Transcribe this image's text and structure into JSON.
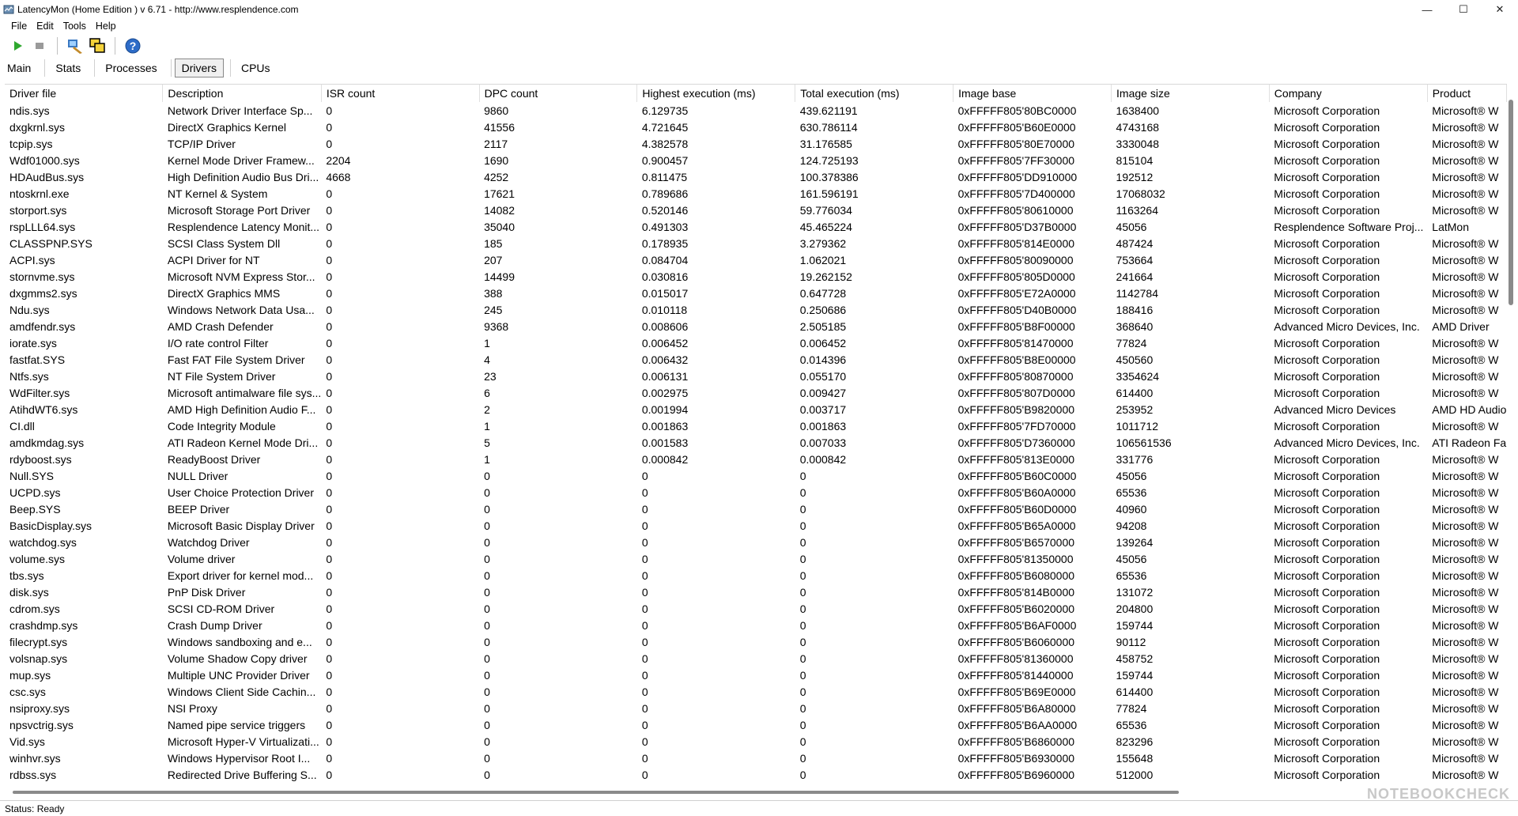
{
  "window": {
    "title": "LatencyMon  (Home Edition )  v 6.71 - http://www.resplendence.com",
    "controls": {
      "minimize": "—",
      "maximize": "☐",
      "close": "✕"
    }
  },
  "menu": [
    "File",
    "Edit",
    "Tools",
    "Help"
  ],
  "toolbar": [
    "start-icon",
    "stop-icon",
    "driver-tool-icon",
    "windows-icon",
    "help-icon"
  ],
  "tabs": [
    {
      "label": "Main",
      "active": false
    },
    {
      "label": "Stats",
      "active": false
    },
    {
      "label": "Processes",
      "active": false
    },
    {
      "label": "Drivers",
      "active": true
    },
    {
      "label": "CPUs",
      "active": false
    }
  ],
  "columns": [
    "Driver file",
    "Description",
    "ISR count",
    "DPC count",
    "Highest execution (ms)",
    "Total execution (ms)",
    "Image base",
    "Image size",
    "Company",
    "Product"
  ],
  "rows": [
    [
      "ndis.sys",
      "Network Driver Interface Sp...",
      "0",
      "9860",
      "6.129735",
      "439.621191",
      "0xFFFFF805'80BC0000",
      "1638400",
      "Microsoft Corporation",
      "Microsoft® W"
    ],
    [
      "dxgkrnl.sys",
      "DirectX Graphics Kernel",
      "0",
      "41556",
      "4.721645",
      "630.786114",
      "0xFFFFF805'B60E0000",
      "4743168",
      "Microsoft Corporation",
      "Microsoft® W"
    ],
    [
      "tcpip.sys",
      "TCP/IP Driver",
      "0",
      "2117",
      "4.382578",
      "31.176585",
      "0xFFFFF805'80E70000",
      "3330048",
      "Microsoft Corporation",
      "Microsoft® W"
    ],
    [
      "Wdf01000.sys",
      "Kernel Mode Driver Framew...",
      "2204",
      "1690",
      "0.900457",
      "124.725193",
      "0xFFFFF805'7FF30000",
      "815104",
      "Microsoft Corporation",
      "Microsoft® W"
    ],
    [
      "HDAudBus.sys",
      "High Definition Audio Bus Dri...",
      "4668",
      "4252",
      "0.811475",
      "100.378386",
      "0xFFFFF805'DD910000",
      "192512",
      "Microsoft Corporation",
      "Microsoft® W"
    ],
    [
      "ntoskrnl.exe",
      "NT Kernel & System",
      "0",
      "17621",
      "0.789686",
      "161.596191",
      "0xFFFFF805'7D400000",
      "17068032",
      "Microsoft Corporation",
      "Microsoft® W"
    ],
    [
      "storport.sys",
      "Microsoft Storage Port Driver",
      "0",
      "14082",
      "0.520146",
      "59.776034",
      "0xFFFFF805'80610000",
      "1163264",
      "Microsoft Corporation",
      "Microsoft® W"
    ],
    [
      "rspLLL64.sys",
      "Resplendence Latency Monit...",
      "0",
      "35040",
      "0.491303",
      "45.465224",
      "0xFFFFF805'D37B0000",
      "45056",
      "Resplendence Software Proj...",
      "LatMon"
    ],
    [
      "CLASSPNP.SYS",
      "SCSI Class System Dll",
      "0",
      "185",
      "0.178935",
      "3.279362",
      "0xFFFFF805'814E0000",
      "487424",
      "Microsoft Corporation",
      "Microsoft® W"
    ],
    [
      "ACPI.sys",
      "ACPI Driver for NT",
      "0",
      "207",
      "0.084704",
      "1.062021",
      "0xFFFFF805'80090000",
      "753664",
      "Microsoft Corporation",
      "Microsoft® W"
    ],
    [
      "stornvme.sys",
      "Microsoft NVM Express Stor...",
      "0",
      "14499",
      "0.030816",
      "19.262152",
      "0xFFFFF805'805D0000",
      "241664",
      "Microsoft Corporation",
      "Microsoft® W"
    ],
    [
      "dxgmms2.sys",
      "DirectX Graphics MMS",
      "0",
      "388",
      "0.015017",
      "0.647728",
      "0xFFFFF805'E72A0000",
      "1142784",
      "Microsoft Corporation",
      "Microsoft® W"
    ],
    [
      "Ndu.sys",
      "Windows Network Data Usa...",
      "0",
      "245",
      "0.010118",
      "0.250686",
      "0xFFFFF805'D40B0000",
      "188416",
      "Microsoft Corporation",
      "Microsoft® W"
    ],
    [
      "amdfendr.sys",
      "AMD Crash Defender",
      "0",
      "9368",
      "0.008606",
      "2.505185",
      "0xFFFFF805'B8F00000",
      "368640",
      "Advanced Micro Devices, Inc.",
      "AMD Driver"
    ],
    [
      "iorate.sys",
      "I/O rate control Filter",
      "0",
      "1",
      "0.006452",
      "0.006452",
      "0xFFFFF805'81470000",
      "77824",
      "Microsoft Corporation",
      "Microsoft® W"
    ],
    [
      "fastfat.SYS",
      "Fast FAT File System Driver",
      "0",
      "4",
      "0.006432",
      "0.014396",
      "0xFFFFF805'B8E00000",
      "450560",
      "Microsoft Corporation",
      "Microsoft® W"
    ],
    [
      "Ntfs.sys",
      "NT File System Driver",
      "0",
      "23",
      "0.006131",
      "0.055170",
      "0xFFFFF805'80870000",
      "3354624",
      "Microsoft Corporation",
      "Microsoft® W"
    ],
    [
      "WdFilter.sys",
      "Microsoft antimalware file sys...",
      "0",
      "6",
      "0.002975",
      "0.009427",
      "0xFFFFF805'807D0000",
      "614400",
      "Microsoft Corporation",
      "Microsoft® W"
    ],
    [
      "AtihdWT6.sys",
      "AMD High Definition Audio F...",
      "0",
      "2",
      "0.001994",
      "0.003717",
      "0xFFFFF805'B9820000",
      "253952",
      "Advanced Micro Devices",
      "AMD HD Audio"
    ],
    [
      "CI.dll",
      "Code Integrity Module",
      "0",
      "1",
      "0.001863",
      "0.001863",
      "0xFFFFF805'7FD70000",
      "1011712",
      "Microsoft Corporation",
      "Microsoft® W"
    ],
    [
      "amdkmdag.sys",
      "ATI Radeon Kernel Mode Dri...",
      "0",
      "5",
      "0.001583",
      "0.007033",
      "0xFFFFF805'D7360000",
      "106561536",
      "Advanced Micro Devices, Inc.",
      "ATI Radeon Fa"
    ],
    [
      "rdyboost.sys",
      "ReadyBoost Driver",
      "0",
      "1",
      "0.000842",
      "0.000842",
      "0xFFFFF805'813E0000",
      "331776",
      "Microsoft Corporation",
      "Microsoft® W"
    ],
    [
      "Null.SYS",
      "NULL Driver",
      "0",
      "0",
      "0",
      "0",
      "0xFFFFF805'B60C0000",
      "45056",
      "Microsoft Corporation",
      "Microsoft® W"
    ],
    [
      "UCPD.sys",
      "User Choice Protection Driver",
      "0",
      "0",
      "0",
      "0",
      "0xFFFFF805'B60A0000",
      "65536",
      "Microsoft Corporation",
      "Microsoft® W"
    ],
    [
      "Beep.SYS",
      "BEEP Driver",
      "0",
      "0",
      "0",
      "0",
      "0xFFFFF805'B60D0000",
      "40960",
      "Microsoft Corporation",
      "Microsoft® W"
    ],
    [
      "BasicDisplay.sys",
      "Microsoft Basic Display Driver",
      "0",
      "0",
      "0",
      "0",
      "0xFFFFF805'B65A0000",
      "94208",
      "Microsoft Corporation",
      "Microsoft® W"
    ],
    [
      "watchdog.sys",
      "Watchdog Driver",
      "0",
      "0",
      "0",
      "0",
      "0xFFFFF805'B6570000",
      "139264",
      "Microsoft Corporation",
      "Microsoft® W"
    ],
    [
      "volume.sys",
      "Volume driver",
      "0",
      "0",
      "0",
      "0",
      "0xFFFFF805'81350000",
      "45056",
      "Microsoft Corporation",
      "Microsoft® W"
    ],
    [
      "tbs.sys",
      "Export driver for kernel mod...",
      "0",
      "0",
      "0",
      "0",
      "0xFFFFF805'B6080000",
      "65536",
      "Microsoft Corporation",
      "Microsoft® W"
    ],
    [
      "disk.sys",
      "PnP Disk Driver",
      "0",
      "0",
      "0",
      "0",
      "0xFFFFF805'814B0000",
      "131072",
      "Microsoft Corporation",
      "Microsoft® W"
    ],
    [
      "cdrom.sys",
      "SCSI CD-ROM Driver",
      "0",
      "0",
      "0",
      "0",
      "0xFFFFF805'B6020000",
      "204800",
      "Microsoft Corporation",
      "Microsoft® W"
    ],
    [
      "crashdmp.sys",
      "Crash Dump Driver",
      "0",
      "0",
      "0",
      "0",
      "0xFFFFF805'B6AF0000",
      "159744",
      "Microsoft Corporation",
      "Microsoft® W"
    ],
    [
      "filecrypt.sys",
      "Windows sandboxing and e...",
      "0",
      "0",
      "0",
      "0",
      "0xFFFFF805'B6060000",
      "90112",
      "Microsoft Corporation",
      "Microsoft® W"
    ],
    [
      "volsnap.sys",
      "Volume Shadow Copy driver",
      "0",
      "0",
      "0",
      "0",
      "0xFFFFF805'81360000",
      "458752",
      "Microsoft Corporation",
      "Microsoft® W"
    ],
    [
      "mup.sys",
      "Multiple UNC Provider Driver",
      "0",
      "0",
      "0",
      "0",
      "0xFFFFF805'81440000",
      "159744",
      "Microsoft Corporation",
      "Microsoft® W"
    ],
    [
      "csc.sys",
      "Windows Client Side Cachin...",
      "0",
      "0",
      "0",
      "0",
      "0xFFFFF805'B69E0000",
      "614400",
      "Microsoft Corporation",
      "Microsoft® W"
    ],
    [
      "nsiproxy.sys",
      "NSI Proxy",
      "0",
      "0",
      "0",
      "0",
      "0xFFFFF805'B6A80000",
      "77824",
      "Microsoft Corporation",
      "Microsoft® W"
    ],
    [
      "npsvctrig.sys",
      "Named pipe service triggers",
      "0",
      "0",
      "0",
      "0",
      "0xFFFFF805'B6AA0000",
      "65536",
      "Microsoft Corporation",
      "Microsoft® W"
    ],
    [
      "Vid.sys",
      "Microsoft Hyper-V Virtualizati...",
      "0",
      "0",
      "0",
      "0",
      "0xFFFFF805'B6860000",
      "823296",
      "Microsoft Corporation",
      "Microsoft® W"
    ],
    [
      "winhvr.sys",
      "Windows Hypervisor Root I...",
      "0",
      "0",
      "0",
      "0",
      "0xFFFFF805'B6930000",
      "155648",
      "Microsoft Corporation",
      "Microsoft® W"
    ],
    [
      "rdbss.sys",
      "Redirected Drive Buffering S...",
      "0",
      "0",
      "0",
      "0",
      "0xFFFFF805'B6960000",
      "512000",
      "Microsoft Corporation",
      "Microsoft® W"
    ]
  ],
  "status": "Status: Ready",
  "watermark": "NOTEBOOKCHECK"
}
